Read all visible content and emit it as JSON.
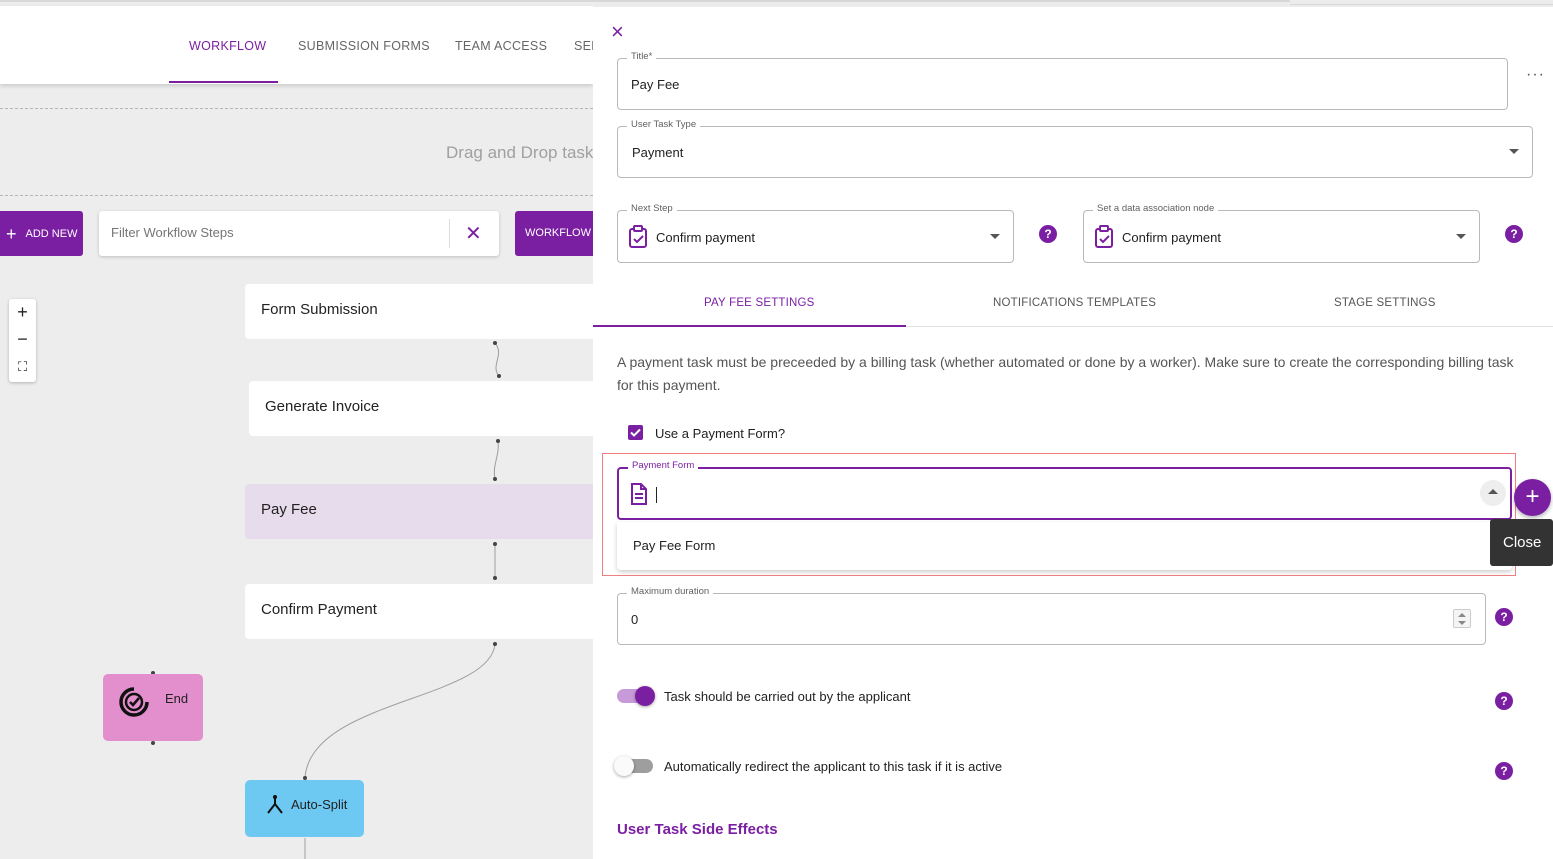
{
  "nav": {
    "tabs": [
      {
        "label": "WORKFLOW"
      },
      {
        "label": "SUBMISSION FORMS"
      },
      {
        "label": "TEAM ACCESS"
      },
      {
        "label": "SEF"
      }
    ]
  },
  "canvas": {
    "dropzone_text": "Drag and Drop task",
    "add_new_label": "ADD NEW",
    "filter_placeholder": "Filter Workflow Steps",
    "workflow_steps_label": "WORKFLOW ST",
    "zoom": {
      "in": "+",
      "out": "−",
      "fit": "⛶"
    },
    "nodes": [
      {
        "label": "Form Submission"
      },
      {
        "label": "Generate Invoice"
      },
      {
        "label": "Pay Fee"
      },
      {
        "label": "Confirm Payment"
      }
    ],
    "end_label": "End",
    "split_label": "Auto-Split"
  },
  "panel": {
    "close_icon": "×",
    "more_icon": "···",
    "title": {
      "label": "Title*",
      "value": "Pay Fee"
    },
    "user_task_type": {
      "label": "User Task Type",
      "value": "Payment"
    },
    "next_step": {
      "label": "Next Step",
      "value": "Confirm payment"
    },
    "data_association": {
      "label": "Set a data association node",
      "value": "Confirm payment"
    },
    "help_glyph": "?",
    "tabs": [
      {
        "label": "PAY FEE SETTINGS"
      },
      {
        "label": "NOTIFICATIONS TEMPLATES"
      },
      {
        "label": "STAGE SETTINGS"
      }
    ],
    "info_text": "A payment task must be preceeded by a billing task (whether automated or done by a worker). Make sure to create the corresponding billing task for this payment.",
    "use_payment_form": {
      "label": "Use a Payment Form?",
      "checked": true
    },
    "payment_form": {
      "label": "Payment Form",
      "value": "",
      "options": [
        "Pay Fee Form"
      ]
    },
    "add_glyph": "+",
    "tooltip": "Close",
    "max_duration": {
      "label": "Maximum duration",
      "value": "0"
    },
    "toggle_applicant": {
      "label": "Task should be carried out by the applicant",
      "on": true
    },
    "toggle_redirect": {
      "label": "Automatically redirect the applicant to this task if it is active",
      "on": false
    },
    "side_effects_heading": "User Task Side Effects"
  },
  "colors": {
    "accent": "#7b1fa2",
    "selected_node": "#e6dcec",
    "end_node": "#e38fcd",
    "split_node": "#6ec9f2",
    "highlight_box": "#f08080"
  }
}
